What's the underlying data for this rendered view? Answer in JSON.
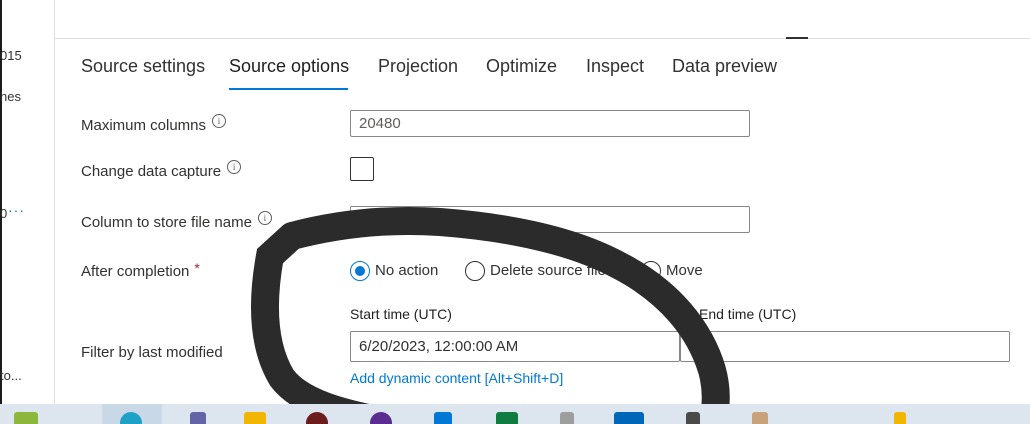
{
  "left_strip": {
    "items": [
      "015",
      "hes",
      "0",
      "to..."
    ],
    "more_dots": "···"
  },
  "tabs": [
    {
      "label": "Source settings",
      "active": false
    },
    {
      "label": "Source options",
      "active": true
    },
    {
      "label": "Projection",
      "active": false
    },
    {
      "label": "Optimize",
      "active": false
    },
    {
      "label": "Inspect",
      "active": false
    },
    {
      "label": "Data preview",
      "active": false
    }
  ],
  "form": {
    "max_columns": {
      "label": "Maximum columns",
      "value": "20480"
    },
    "change_data_capture": {
      "label": "Change data capture",
      "checked": false
    },
    "column_file_name": {
      "label": "Column to store file name",
      "value": ""
    },
    "after_completion": {
      "label": "After completion",
      "required_mark": "*",
      "options": [
        "No action",
        "Delete source files",
        "Move"
      ],
      "selected": "No action"
    },
    "filter_last_modified": {
      "label": "Filter by last modified",
      "start_label": "Start time (UTC)",
      "start_value": "6/20/2023, 12:00:00 AM",
      "end_label": "End time (UTC)",
      "end_value": "",
      "dynamic_link": "Add dynamic content [Alt+Shift+D]"
    }
  },
  "info_glyph": "i",
  "colors": {
    "accent": "#0078d4",
    "required": "#a4262c",
    "taskbar": "#dde6ef",
    "scribble": "#2b2b2b"
  },
  "taskbar_icons": [
    "app-icon",
    "edge-icon",
    "teams-icon",
    "folder-icon",
    "app-icon",
    "app-icon",
    "vscode-icon",
    "excel-icon",
    "app-icon",
    "store-icon",
    "app-icon",
    "app-icon",
    "app-icon"
  ]
}
